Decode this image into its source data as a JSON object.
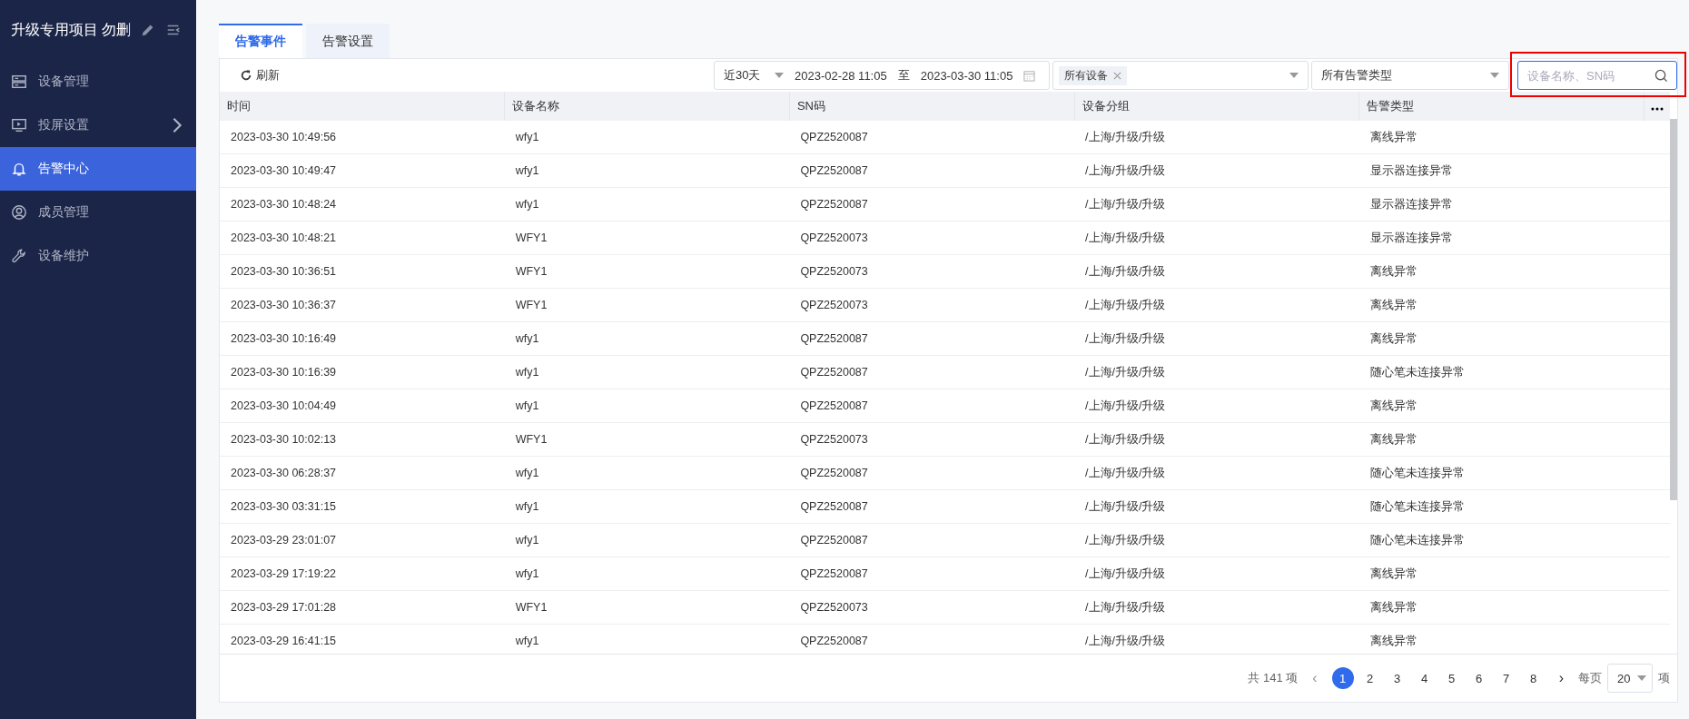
{
  "sidebar": {
    "title": "升级专用项目 勿删",
    "items": [
      {
        "kind": "server",
        "label": "设备管理",
        "selected": false,
        "has_submenu": false
      },
      {
        "kind": "monitor",
        "label": "投屏设置",
        "selected": false,
        "has_submenu": true
      },
      {
        "kind": "bell",
        "label": "告警中心",
        "selected": true,
        "has_submenu": false
      },
      {
        "kind": "user",
        "label": "成员管理",
        "selected": false,
        "has_submenu": false
      },
      {
        "kind": "wrench",
        "label": "设备维护",
        "selected": false,
        "has_submenu": false
      }
    ]
  },
  "tabs": [
    {
      "label": "告警事件",
      "selected": true
    },
    {
      "label": "告警设置",
      "selected": false
    }
  ],
  "toolbar": {
    "refresh": "刷新",
    "range": "近30天",
    "date_start": "2023-02-28 11:05",
    "date_sep": "至",
    "date_end": "2023-03-30 11:05",
    "device_tag": "所有设备",
    "alarm_type": "所有告警类型",
    "search": {
      "placeholder": "设备名称、SN码",
      "highlighted": true
    }
  },
  "table": {
    "columns": [
      "时间",
      "设备名称",
      "SN码",
      "设备分组",
      "告警类型"
    ],
    "rows": [
      [
        "2023-03-30 10:49:56",
        "wfy1",
        "QPZ2520087",
        "/上海/升级/升级",
        "离线异常"
      ],
      [
        "2023-03-30 10:49:47",
        "wfy1",
        "QPZ2520087",
        "/上海/升级/升级",
        "显示器连接异常"
      ],
      [
        "2023-03-30 10:48:24",
        "wfy1",
        "QPZ2520087",
        "/上海/升级/升级",
        "显示器连接异常"
      ],
      [
        "2023-03-30 10:48:21",
        "WFY1",
        "QPZ2520073",
        "/上海/升级/升级",
        "显示器连接异常"
      ],
      [
        "2023-03-30 10:36:51",
        "WFY1",
        "QPZ2520073",
        "/上海/升级/升级",
        "离线异常"
      ],
      [
        "2023-03-30 10:36:37",
        "WFY1",
        "QPZ2520073",
        "/上海/升级/升级",
        "离线异常"
      ],
      [
        "2023-03-30 10:16:49",
        "wfy1",
        "QPZ2520087",
        "/上海/升级/升级",
        "离线异常"
      ],
      [
        "2023-03-30 10:16:39",
        "wfy1",
        "QPZ2520087",
        "/上海/升级/升级",
        "随心笔未连接异常"
      ],
      [
        "2023-03-30 10:04:49",
        "wfy1",
        "QPZ2520087",
        "/上海/升级/升级",
        "离线异常"
      ],
      [
        "2023-03-30 10:02:13",
        "WFY1",
        "QPZ2520073",
        "/上海/升级/升级",
        "离线异常"
      ],
      [
        "2023-03-30 06:28:37",
        "wfy1",
        "QPZ2520087",
        "/上海/升级/升级",
        "随心笔未连接异常"
      ],
      [
        "2023-03-30 03:31:15",
        "wfy1",
        "QPZ2520087",
        "/上海/升级/升级",
        "随心笔未连接异常"
      ],
      [
        "2023-03-29 23:01:07",
        "wfy1",
        "QPZ2520087",
        "/上海/升级/升级",
        "随心笔未连接异常"
      ],
      [
        "2023-03-29 17:19:22",
        "wfy1",
        "QPZ2520087",
        "/上海/升级/升级",
        "离线异常"
      ],
      [
        "2023-03-29 17:01:28",
        "WFY1",
        "QPZ2520073",
        "/上海/升级/升级",
        "离线异常"
      ],
      [
        "2023-03-29 16:41:15",
        "wfy1",
        "QPZ2520087",
        "/上海/升级/升级",
        "离线异常"
      ]
    ]
  },
  "pagination": {
    "total": "共 141 项",
    "prev": "‹",
    "next": "›",
    "pages": [
      {
        "label": "1",
        "selected": true
      },
      {
        "label": "2",
        "selected": false
      },
      {
        "label": "3",
        "selected": false
      },
      {
        "label": "4",
        "selected": false
      },
      {
        "label": "5",
        "selected": false
      },
      {
        "label": "6",
        "selected": false
      },
      {
        "label": "7",
        "selected": false
      },
      {
        "label": "8",
        "selected": false
      }
    ],
    "per_page_label": "每页",
    "per_page": "20",
    "unit": "项"
  }
}
